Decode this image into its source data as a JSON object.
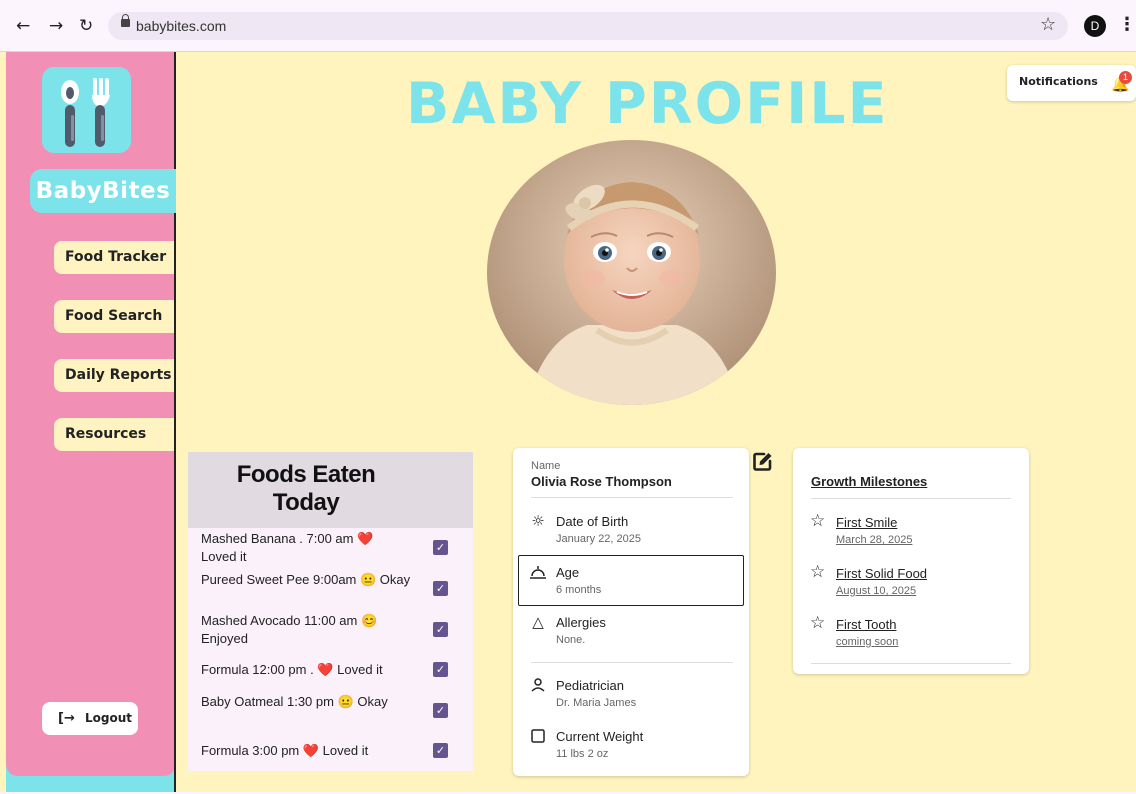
{
  "browser": {
    "url": "babybites.com",
    "profile_initial": "D"
  },
  "sidebar": {
    "brand": "BabyBites",
    "items": [
      {
        "label": "Food Tracker"
      },
      {
        "label": "Food Search"
      },
      {
        "label": "Daily Reports"
      },
      {
        "label": "Resources"
      }
    ],
    "logout_label": "Logout"
  },
  "header": {
    "title": "BABY PROFILE",
    "notifications_label": "Notifications",
    "notifications_count": "1"
  },
  "foods": {
    "title_line1": "Foods Eaten",
    "title_line2": "Today",
    "items": [
      {
        "line1": "Mashed Banana  .  7:00 am ❤️",
        "line2": "Loved it",
        "checked": true
      },
      {
        "line1": "Pureed Sweet Pee 9:00am 😐 Okay",
        "line2": "",
        "checked": true
      },
      {
        "line1": "Mashed Avocado 11:00 am 😊",
        "line2": "Enjoyed",
        "checked": true
      },
      {
        "line1": "Formula 12:00 pm .    ❤️ Loved it",
        "line2": "",
        "checked": true
      },
      {
        "line1": "Baby Oatmeal 1:30 pm  😐 Okay",
        "line2": "",
        "checked": true
      },
      {
        "line1": "Formula  3:00 pm     ❤️ Loved it",
        "line2": "",
        "checked": true
      }
    ]
  },
  "profile": {
    "name_label": "Name",
    "name_value": "Olivia Rose Thompson",
    "fields": [
      {
        "icon": "sun-icon",
        "label": "Date of Birth",
        "value": "January 22, 2025"
      },
      {
        "icon": "sunrise-icon",
        "label": "Age",
        "value": "6 months"
      },
      {
        "icon": "warning-triangle-icon",
        "label": "Allergies",
        "value": "None."
      },
      {
        "icon": "person-icon",
        "label": "Pediatrician",
        "value": "Dr. Maria James"
      },
      {
        "icon": "square-icon",
        "label": "Current Weight",
        "value": "11 lbs 2 oz"
      }
    ]
  },
  "milestones": {
    "title": "Growth Milestones",
    "items": [
      {
        "label": "First Smile",
        "date": "March 28, 2025"
      },
      {
        "label": "First Solid Food",
        "date": "August 10, 2025"
      },
      {
        "label": "First Tooth",
        "date": "coming soon"
      }
    ]
  },
  "colors": {
    "page_background": "#fff4bd",
    "sidebar_pink": "#f28fb5",
    "accent_cyan": "#7de3ea",
    "checkbox_purple": "#65558f"
  }
}
